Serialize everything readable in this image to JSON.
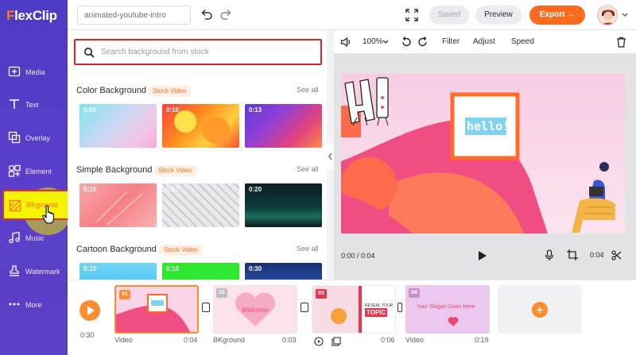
{
  "app": {
    "logo_text_prefix": "F",
    "logo_text_rest": "lexClip"
  },
  "nav": {
    "items": [
      {
        "label": "Media",
        "icon": "media-icon"
      },
      {
        "label": "Text",
        "icon": "text-icon"
      },
      {
        "label": "Overlay",
        "icon": "overlay-icon"
      },
      {
        "label": "Element",
        "icon": "element-icon"
      },
      {
        "label": "BKground",
        "icon": "background-icon",
        "active": true
      },
      {
        "label": "Music",
        "icon": "music-icon"
      },
      {
        "label": "Watermark",
        "icon": "watermark-icon"
      },
      {
        "label": "More",
        "icon": "more-icon"
      }
    ]
  },
  "topbar": {
    "project_name": "animated-youtube-intro",
    "saved_label": "Saved",
    "preview_label": "Preview",
    "export_label": "Export →"
  },
  "panel": {
    "search_placeholder": "Search background from stock",
    "sections": [
      {
        "title": "Color Background",
        "badge": "Stock Video",
        "see_all": "See all",
        "thumbs": [
          "0:09",
          "0:10",
          "0:13"
        ]
      },
      {
        "title": "Simple Background",
        "badge": "Stock Video",
        "see_all": "See all",
        "thumbs": [
          "0:10",
          "0:07",
          "0:20"
        ]
      },
      {
        "title": "Cartoon Background",
        "badge": "Stock Video",
        "see_all": "See all",
        "thumbs": [
          "0:10",
          "0:10",
          "0:30"
        ]
      }
    ]
  },
  "editor_toolbar": {
    "zoom": "100%",
    "filter_label": "Filter",
    "adjust_label": "Adjust",
    "speed_label": "Speed"
  },
  "canvas": {
    "hello_text": "hello!"
  },
  "player": {
    "time": "0:00 / 0:04",
    "clip_duration": "0:04"
  },
  "timeline": {
    "total": "0:30",
    "clips": [
      {
        "num": "01",
        "type": "Video",
        "duration": "0:04"
      },
      {
        "num": "02",
        "type": "BKground",
        "duration": "0:03",
        "title": "Welcome"
      },
      {
        "num": "03",
        "type": "",
        "duration": "0:06",
        "text1": "REVEAL YOUR",
        "text2": "TOPIC"
      },
      {
        "num": "04",
        "type": "Video",
        "duration": "0:19",
        "slogan": "Your Slogan Goes Here"
      }
    ],
    "add_label": "+"
  },
  "colors": {
    "brand": "#5a3fc9",
    "accent": "#ff6a1e",
    "highlight": "#f5f400"
  }
}
